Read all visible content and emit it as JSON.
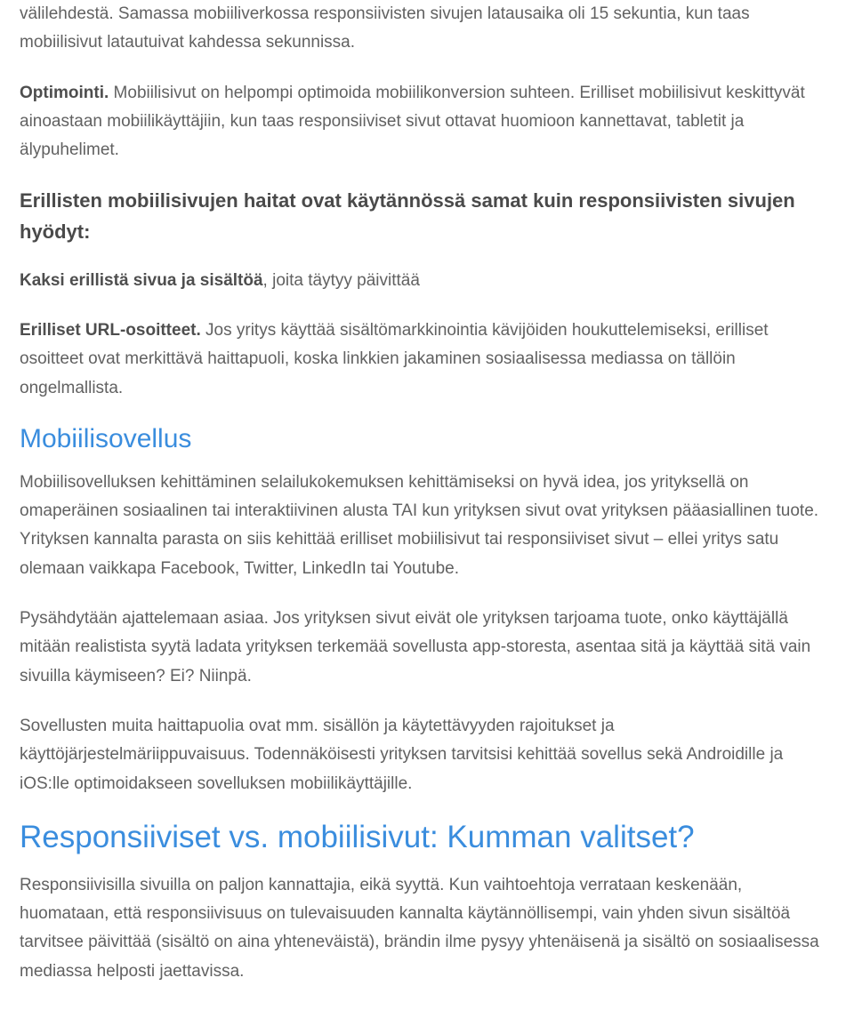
{
  "p1_a": "välilehdestä. Samassa mobiiliverkossa responsiivisten sivujen latausaika oli 15 sekuntia, kun taas mobiilisivut latautuivat kahdessa sekunnissa.",
  "p2_bold": "Optimointi.",
  "p2_rest": " Mobiilisivut on helpompi optimoida mobiilikonversion suhteen. Erilliset mobiilisivut keskittyvät ainoastaan mobiilikäyttäjiin, kun taas responsiiviset sivut ottavat huomioon kannettavat, tabletit ja älypuhelimet.",
  "h3_1": "Erillisten mobiilisivujen haitat ovat käytännössä samat kuin responsiivisten sivujen hyödyt:",
  "p3_bold": "Kaksi erillistä sivua ja sisältöä",
  "p3_rest": ", joita täytyy päivittää",
  "p4_bold": "Erilliset URL-osoitteet.",
  "p4_rest": " Jos yritys käyttää sisältömarkkinointia kävijöiden houkuttelemiseksi, erilliset osoitteet ovat merkittävä haittapuoli, koska linkkien jakaminen sosiaalisessa mediassa on tällöin ongelmallista.",
  "h2_1": "Mobiilisovellus",
  "p5": "Mobiilisovelluksen kehittäminen selailukokemuksen kehittämiseksi on hyvä idea, jos yrityksellä on omaperäinen sosiaalinen tai interaktiivinen alusta TAI kun yrityksen sivut ovat yrityksen pääasiallinen tuote. Yrityksen kannalta parasta on siis kehittää erilliset mobiilisivut tai responsiiviset sivut – ellei yritys satu olemaan vaikkapa Facebook, Twitter, LinkedIn tai Youtube.",
  "p6": "Pysähdytään ajattelemaan asiaa. Jos yrityksen sivut eivät ole yrityksen tarjoama tuote, onko käyttäjällä mitään realistista syytä ladata yrityksen terkemää sovellusta app-storesta, asentaa sitä ja käyttää sitä vain sivuilla käymiseen? Ei? Niinpä.",
  "p7": "Sovellusten muita haittapuolia ovat mm. sisällön ja käytettävyyden rajoitukset ja käyttöjärjestelmäriippuvaisuus. Todennäköisesti yrityksen tarvitsisi kehittää sovellus sekä Androidille ja iOS:lle optimoidakseen sovelluksen mobiilikäyttäjille.",
  "h1_1": "Responsiiviset vs. mobiilisivut: Kumman valitset?",
  "p8": "Responsiivisilla sivuilla on paljon kannattajia, eikä syyttä. Kun vaihtoehtoja verrataan keskenään, huomataan, että responsiivisuus on tulevaisuuden kannalta käytännöllisempi, vain yhden sivun sisältöä tarvitsee päivittää (sisältö on aina yhteneväistä), brändin ilme pysyy yhtenäisenä ja sisältö on sosiaalisessa mediassa helposti jaettavissa."
}
